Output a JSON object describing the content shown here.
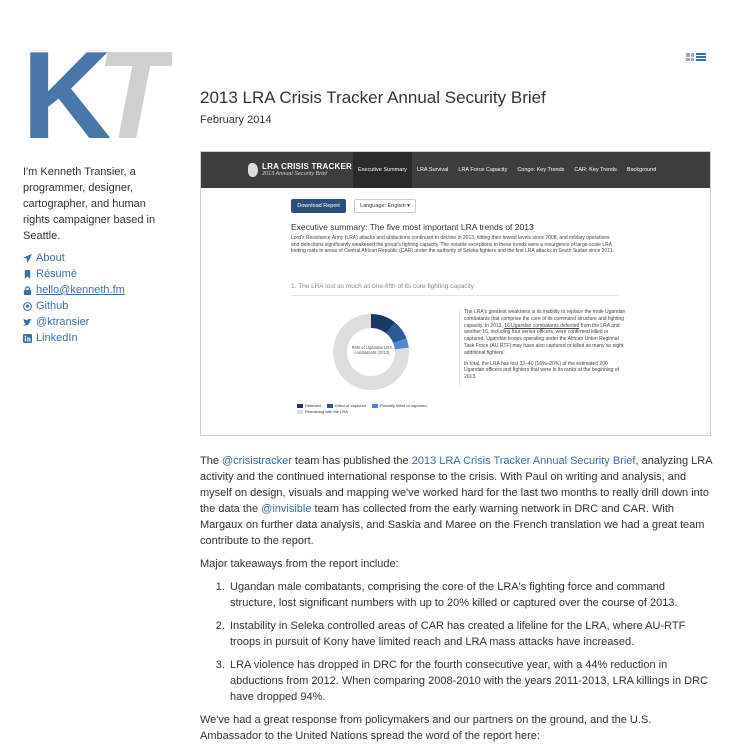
{
  "logo": {
    "letter1": "K",
    "letter2": "T",
    "color1": "#4a77a8",
    "color2": "#cfcfcf"
  },
  "sidebar": {
    "bio": "I'm Kenneth Transier, a programmer, designer, cartographer, and human rights campaigner based in Seattle.",
    "links": [
      {
        "icon": "paper-plane-icon",
        "label": "About"
      },
      {
        "icon": "bookmark-icon",
        "label": "Résumé"
      },
      {
        "icon": "lock-icon",
        "label": "hello@kenneth.fm"
      },
      {
        "icon": "github-icon",
        "label": "Github"
      },
      {
        "icon": "twitter-icon",
        "label": "@ktransier"
      },
      {
        "icon": "linkedin-icon",
        "label": "LinkedIn"
      }
    ]
  },
  "post": {
    "title": "2013 LRA Crisis Tracker Annual Security Brief",
    "date": "February 2014"
  },
  "figure": {
    "brand_title": "LRA CRISIS TRACKER",
    "brand_sub": "2013 Annual Security Brief",
    "tabs": [
      "Executive Summary",
      "LRA Survival",
      "LRA Force Capacity",
      "Congo: Key Trends",
      "CAR: Key Trends",
      "Background"
    ],
    "download_label": "Download Report",
    "language_label": "Language: English ▾",
    "heading": "Executive summary: The five most important LRA trends of 2013",
    "intro": "Lord's Resistance Army (LRA) attacks and abductions continued to decline in 2013, hitting their lowest levels since 2008, and military operations and defections significantly weakened the group's fighting capacity. The notable exceptions to these trends were a resurgence of large-scale LRA looting raids in areas of Central African Republic (CAR) under the authority of Seleka fighters and the first LRA attacks in South Sudan since 2011.",
    "subheading": "1. The LRA lost as much as one-fifth of its core fighting capacity",
    "donut_label": "Pets of Ugandan LRA combatants (2013)",
    "legend": {
      "defected": "Defected",
      "killed": "Killed or captured",
      "possibly": "Possibly killed or captured",
      "remaining": "Remaining with the LRA"
    },
    "side_p1_a": "The LRA's greatest weakness is its inability to replace the male Ugandan combatants that comprise the core of its command structure and fighting capacity. In 2013, ",
    "side_p1_link": "16 Ugandan combatants defected",
    "side_p1_b": " from the LRA and another 16, including four senior officers, were confirmed killed or captured. Ugandan troops operating under the African Union Regional Task Force (AU RTF) may have also captured or killed as many as eight additional fighters.",
    "side_p2": "In total, the LRA has lost 32–40 (16%–20%) of the estimated 200 Ugandan officers and fighters that were in its ranks at the beginning of 2013."
  },
  "article": {
    "p1_a": "The ",
    "p1_link1": "@crisistracker",
    "p1_b": " team has published the ",
    "p1_link2": "2013 LRA Crisis Tracker Annual Security Brief",
    "p1_c": ", analyzing LRA activity and the continued international response to the crisis. With Paul on writing and analysis, and myself on design, visuals and mapping we've worked hard for the last two months to really drill down into the data the ",
    "p1_link3": "@invisible",
    "p1_d": " team has collected from the early warning network in DRC and CAR. With Margaux on further data analysis, and Saskia and Maree on the French translation we had a great team contribute to the report.",
    "p2": "Major takeaways from the report include:",
    "items": [
      "Ugandan male combatants, comprising the core of the LRA's fighting force and command structure, lost significant numbers with up to 20% killed or captured over the course of 2013.",
      "Instability in Seleka controlled areas of CAR has created a lifeline for the LRA, where AU-RTF troops in pursuit of Kony have limited reach and LRA mass attacks have increased.",
      "LRA violence has dropped in DRC for the fourth consecutive year, with a 44% reduction in abductions from 2012. When comparing 2008-2010 with the years 2011-2013, LRA killings in DRC have dropped 94%."
    ],
    "p3": "We've had a great response from policymakers and our partners on the ground, and the U.S. Ambassador to the United Nations spread the word of the report here:"
  }
}
